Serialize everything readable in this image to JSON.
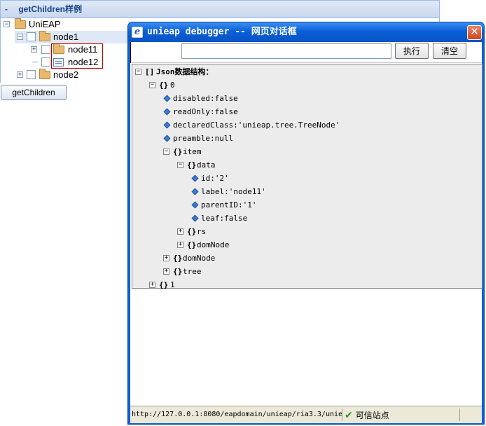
{
  "panel": {
    "dash": "-",
    "title": "getChildren样例"
  },
  "tree": {
    "root": "UniEAP",
    "node1": "node1",
    "node11": "node11",
    "node12": "node12",
    "node2": "node2"
  },
  "main_button_label": "getChildren",
  "dialog": {
    "title": "unieap debugger -- 网页对话框",
    "close_symbol": "✕",
    "search": {
      "value": "",
      "placeholder": ""
    },
    "run_label": "执行",
    "clear_label": "清空"
  },
  "json_tree": {
    "root": {
      "bracket": "[]",
      "label": "Json数据结构："
    },
    "obj0": {
      "bracket": "{}",
      "label": "0"
    },
    "disabled": "disabled:false",
    "readOnly": "readOnly:false",
    "declaredClass": "declaredClass:'unieap.tree.TreeNode'",
    "preamble": "preamble:null",
    "item": {
      "bracket": "{}",
      "label": "item"
    },
    "data": {
      "bracket": "{}",
      "label": "data"
    },
    "id": "id:'2'",
    "label": "label:'node11'",
    "parentID": "parentID:'1'",
    "leaf": "leaf:false",
    "rs": {
      "bracket": "{}",
      "label": "rs"
    },
    "domNode_inner": {
      "bracket": "{}",
      "label": "domNode"
    },
    "domNode": {
      "bracket": "{}",
      "label": "domNode"
    },
    "tree": {
      "bracket": "{}",
      "label": "tree"
    },
    "obj1": {
      "bracket": "{}",
      "label": "1"
    }
  },
  "status": {
    "url": "http://127.0.0.1:8080/eapdomain/unieap/ria3.3/unie",
    "zone": "可信站点"
  }
}
